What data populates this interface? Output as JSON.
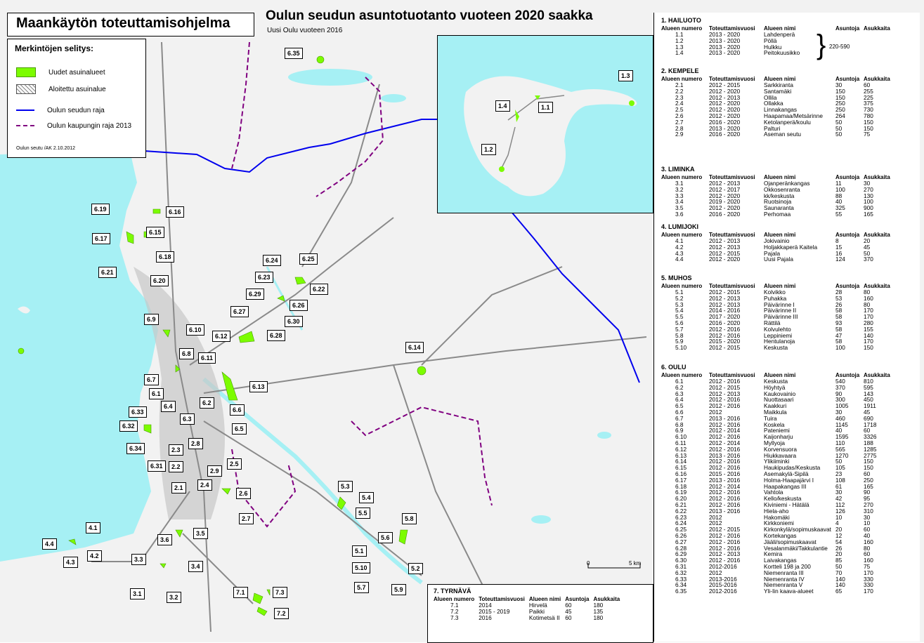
{
  "header": {
    "program_title": "Maankäytön toteuttamisohjelma",
    "map_title": "Oulun seudun asuntotuotanto vuoteen 2020 saakka",
    "map_subtitle": "Uusi Oulu vuoteen 2016"
  },
  "legend": {
    "title": "Merkintöjen selitys:",
    "items": [
      {
        "label": "Uudet asuinalueet",
        "color": "#7CFC00"
      },
      {
        "label": "Aloitettu asuinalue",
        "color": "#cccccc"
      },
      {
        "label": "Oulun seudun raja",
        "color": "#0000ee"
      },
      {
        "label": "Oulun kaupungin raja 2013",
        "color": "#800080"
      }
    ],
    "credit": "Oulun seutu /AK 2.10.2012"
  },
  "colors": {
    "water": "#a6f0f4",
    "new_area": "#7CFC00",
    "road": "#888888",
    "urban": "#c8c8c8",
    "region_border": "#0000ee",
    "city_border": "#800080"
  },
  "scale": {
    "zero": "0",
    "end": "5 km"
  },
  "columns": {
    "num": "Alueen numero",
    "years": "Toteuttamisvuosi",
    "name": "Alueen nimi",
    "units": "Asuntoja",
    "residents": "Asukkaita"
  },
  "sections": [
    {
      "title": "1. HAILUOTO",
      "brace_value": "220-590",
      "rows": [
        [
          "1.1",
          "2013 - 2020",
          "Lahdenperä",
          "",
          ""
        ],
        [
          "1.2",
          "2013 - 2020",
          "Pöllä",
          "",
          ""
        ],
        [
          "1.3",
          "2013 - 2020",
          "Hulkku",
          "",
          ""
        ],
        [
          "1.4",
          "2013 - 2020",
          "Peitokuusikko",
          "",
          ""
        ]
      ]
    },
    {
      "title": "2. KEMPELE",
      "rows": [
        [
          "2.1",
          "2012 - 2015",
          "Sarkkiranta",
          "30",
          "60"
        ],
        [
          "2.2",
          "2012 - 2020",
          "Santamäki",
          "150",
          "255"
        ],
        [
          "2.3",
          "2012 - 2013",
          "Ollila",
          "150",
          "225"
        ],
        [
          "2.4",
          "2012 - 2020",
          "Ollakka",
          "250",
          "375"
        ],
        [
          "2.5",
          "2012 - 2020",
          "Linnakangas",
          "250",
          "730"
        ],
        [
          "2.6",
          "2012 - 2020",
          "Haapamaa/Metsärinne",
          "264",
          "780"
        ],
        [
          "2.7",
          "2016 - 2020",
          "Ketolanperä/koulu",
          "50",
          "150"
        ],
        [
          "2.8",
          "2013 - 2020",
          "Palturi",
          "50",
          "150"
        ],
        [
          "2.9",
          "2016 - 2020",
          "Aseman seutu",
          "50",
          "75"
        ]
      ]
    },
    {
      "title": "3. LIMINKA",
      "rows": [
        [
          "3.1",
          "2012 - 2013",
          "Ojanperänkangas",
          "11",
          "30"
        ],
        [
          "3.2",
          "2012 - 2017",
          "Okkosenranta",
          "100",
          "270"
        ],
        [
          "3.3",
          "2012 - 2020",
          "kk/keskusta",
          "88",
          "130"
        ],
        [
          "3.4",
          "2019 - 2020",
          "Ruotsinoja",
          "40",
          "100"
        ],
        [
          "3.5",
          "2012 - 2020",
          "Saunaranta",
          "325",
          "900"
        ],
        [
          "3.6",
          "2016 - 2020",
          "Perhomaa",
          "55",
          "165"
        ]
      ]
    },
    {
      "title": "4. LUMIJOKI",
      "rows": [
        [
          "4.1",
          "2012 - 2013",
          "Jokivainio",
          "8",
          "20"
        ],
        [
          "4.2",
          "2012 - 2013",
          "Holjakkaperä Kaitela",
          "15",
          "45"
        ],
        [
          "4.3",
          "2012 - 2015",
          "Pajala",
          "16",
          "50"
        ],
        [
          "4.4",
          "2012 - 2020",
          "Uusi Pajala",
          "124",
          "370"
        ]
      ]
    },
    {
      "title": "5. MUHOS",
      "rows": [
        [
          "5.1",
          "2012 - 2015",
          "Kolvikko",
          "28",
          "80"
        ],
        [
          "5.2",
          "2012 - 2013",
          "Puhakka",
          "53",
          "160"
        ],
        [
          "5.3",
          "2012 - 2013",
          "Päivärinne I",
          "26",
          "80"
        ],
        [
          "5.4",
          "2014 - 2016",
          "Päivärinne II",
          "58",
          "170"
        ],
        [
          "5.5",
          "2017 - 2020",
          "Päivärinne III",
          "58",
          "170"
        ],
        [
          "5.6",
          "2016 - 2020",
          "Rättilä",
          "93",
          "280"
        ],
        [
          "5.7",
          "2012 - 2016",
          "Kolvulehto",
          "58",
          "155"
        ],
        [
          "5.8",
          "2012 - 2016",
          "Leppiniemi",
          "47",
          "140"
        ],
        [
          "5.9",
          "2015 - 2020",
          "Hentulanoja",
          "58",
          "170"
        ],
        [
          "5.10",
          "2012 - 2015",
          "Keskusta",
          "100",
          "150"
        ]
      ]
    },
    {
      "title": "6. OULU",
      "rows": [
        [
          "6.1",
          "2012 - 2016",
          "Keskusta",
          "540",
          "810"
        ],
        [
          "6.2",
          "2012 - 2015",
          "Höyhtyä",
          "370",
          "595"
        ],
        [
          "6.3",
          "2012 - 2013",
          "Kaukovainio",
          "90",
          "143"
        ],
        [
          "6.4",
          "2012 - 2016",
          "Nuottasaari",
          "300",
          "450"
        ],
        [
          "6.5",
          "2012 - 2016",
          "Kaakkuri",
          "1005",
          "1911"
        ],
        [
          "6.6",
          "2012",
          "Maikkula",
          "30",
          "45"
        ],
        [
          "6.7",
          "2013 - 2016",
          "Tuira",
          "460",
          "690"
        ],
        [
          "6.8",
          "2012 - 2016",
          "Koskela",
          "1145",
          "1718"
        ],
        [
          "6.9",
          "2012 - 2014",
          "Pateniemi",
          "40",
          "60"
        ],
        [
          "6.10",
          "2012 - 2016",
          "Kaijonharju",
          "1595",
          "3326"
        ],
        [
          "6.11",
          "2012 - 2014",
          "Myllyoja",
          "110",
          "188"
        ],
        [
          "6.12",
          "2012 - 2016",
          "Korvensuora",
          "565",
          "1285"
        ],
        [
          "6.13",
          "2013 - 2016",
          "Hiukkavaara",
          "1270",
          "2775"
        ],
        [
          "6.14",
          "2012 - 2016",
          "Ylikiiminki",
          "50",
          "150"
        ],
        [
          "6.15",
          "2012 - 2016",
          "Haukipudas/Keskusta",
          "105",
          "150"
        ],
        [
          "6.16",
          "2015 - 2016",
          "Asemakylä-Sipilä",
          "23",
          "60"
        ],
        [
          "6.17",
          "2013 - 2016",
          "Holma-Haapajärvi I",
          "108",
          "250"
        ],
        [
          "6.18",
          "2012 - 2014",
          "Haapakangas III",
          "61",
          "165"
        ],
        [
          "6.19",
          "2012 - 2016",
          "Vahtola",
          "30",
          "90"
        ],
        [
          "6.20",
          "2012 - 2016",
          "Kello/keskusta",
          "42",
          "95"
        ],
        [
          "6.21",
          "2012 - 2016",
          "Kiviniemi - Hätälä",
          "112",
          "270"
        ],
        [
          "6.22",
          "2013 - 2016",
          "Hiela-aho",
          "126",
          "310"
        ],
        [
          "6.23",
          "2012",
          "Hakomäki",
          "10",
          "30"
        ],
        [
          "6.24",
          "2012",
          "Kirkkoniemi",
          "4",
          "10"
        ],
        [
          "6.25",
          "2012 - 2015",
          "Kirkonkylä/sopimuskaavat",
          "20",
          "60"
        ],
        [
          "6.26",
          "2012 - 2016",
          "Kortekangas",
          "12",
          "40"
        ],
        [
          "6.27",
          "2012 - 2016",
          "Jääli/sopimuskaavat",
          "54",
          "160"
        ],
        [
          "6.28",
          "2012 - 2016",
          "Vesalanmäki/Takkulantie",
          "26",
          "80"
        ],
        [
          "6.29",
          "2012 - 2013",
          "Kemira",
          "20",
          "60"
        ],
        [
          "6.30",
          "2012 - 2016",
          "Laivakangas",
          "85",
          "160"
        ],
        [
          "6.31",
          "2012-2016",
          "Kortteli 198 ja 200",
          "50",
          "75"
        ],
        [
          "6.32",
          "2012",
          "Niemenranta III",
          "70",
          "170"
        ],
        [
          "6.33",
          "2013-2016",
          "Niemenranta IV",
          "140",
          "330"
        ],
        [
          "6.34",
          "2015-2016",
          "Niemenranta V",
          "140",
          "330"
        ],
        [
          "6.35",
          "2012-2016",
          "Yli-Iin kaava-alueet",
          "65",
          "170"
        ]
      ]
    }
  ],
  "tyrnava": {
    "title": "7. TYRNÄVÄ",
    "rows": [
      [
        "7.1",
        "2014",
        "Hirvelä",
        "60",
        "180"
      ],
      [
        "7.2",
        "2015 - 2019",
        "Paikki",
        "45",
        "135"
      ],
      [
        "7.3",
        "2016",
        "Kotimetsä II",
        "60",
        "180"
      ]
    ]
  },
  "map_labels": [
    "6.35",
    "6.19",
    "6.16",
    "6.17",
    "6.15",
    "6.18",
    "6.21",
    "6.20",
    "6.24",
    "6.25",
    "6.23",
    "6.22",
    "6.29",
    "6.26",
    "6.27",
    "6.30",
    "6.28",
    "6.9",
    "6.10",
    "6.12",
    "6.14",
    "6.8",
    "6.11",
    "6.7",
    "6.13",
    "6.1",
    "6.4",
    "6.2",
    "6.6",
    "6.3",
    "6.33",
    "6.5",
    "6.32",
    "6.34",
    "2.8",
    "2.3",
    "2.5",
    "6.31",
    "2.2",
    "2.9",
    "2.1",
    "2.4",
    "2.6",
    "5.3",
    "5.4",
    "5.5",
    "2.7",
    "5.8",
    "4.1",
    "3.6",
    "3.5",
    "5.6",
    "4.4",
    "4.2",
    "4.3",
    "3.3",
    "3.4",
    "5.1",
    "5.10",
    "5.2",
    "5.7",
    "5.9",
    "3.1",
    "3.2",
    "7.1",
    "7.3",
    "7.2",
    "1.3",
    "1.4",
    "1.1",
    "1.2"
  ]
}
